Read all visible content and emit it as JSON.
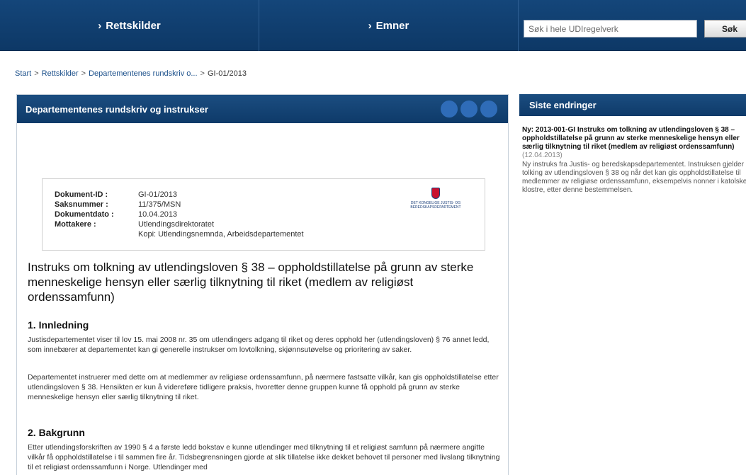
{
  "nav": {
    "tab1": "Rettskilder",
    "tab2": "Emner",
    "chevron": "›",
    "search_placeholder": "Søk i hele UDIregelverk",
    "search_button": "Søk"
  },
  "breadcrumb": {
    "items": [
      "Start",
      "Rettskilder",
      "Departementenes rundskriv o...",
      "GI-01/2013"
    ],
    "separator": ">"
  },
  "panel": {
    "title": "Departementenes rundskriv og instrukser"
  },
  "meta": {
    "rows": [
      {
        "label": "Dokument-ID :",
        "value": "GI-01/2013"
      },
      {
        "label": "Saksnummer :",
        "value": "11/375/MSN"
      },
      {
        "label": "Dokumentdato :",
        "value": "10.04.2013"
      },
      {
        "label": "Mottakere :",
        "value": "Utlendingsdirektoratet"
      },
      {
        "label": "",
        "value": "Kopi: Utlendingsnemnda, Arbeidsdepartementet"
      }
    ],
    "logo_text": "DET KONGELIGE JUSTIS- OG BEREDSKAPSDEPARTEMENT"
  },
  "doc": {
    "title": "Instruks om tolkning av utlendingsloven § 38 – oppholdstillatelse på grunn av sterke menneskelige hensyn eller særlig tilknytning til riket (medlem av religiøst ordenssamfunn)",
    "section1_heading": "1. Innledning",
    "section1_p1": "Justisdepartementet viser til lov 15. mai 2008 nr. 35 om utlendingers adgang til riket og deres opphold her (utlendingsloven) § 76 annet ledd, som innebærer at departementet kan gi generelle instrukser om lovtolkning, skjønnsutøvelse og prioritering av saker.",
    "section1_p2": "Departementet instruerer med dette om at medlemmer av religiøse ordenssamfunn, på nærmere fastsatte vilkår, kan gis oppholdstillatelse etter utlendingsloven § 38. Hensikten er kun å videreføre tidligere praksis, hvoretter denne gruppen kunne få opphold på grunn av sterke menneskelige hensyn eller særlig tilknytning til riket.",
    "section2_heading": "2. Bakgrunn",
    "section2_p1": "Etter utlendingsforskriften av 1990 § 4 a første ledd bokstav e kunne utlendinger med tilknytning til et religiøst samfunn på nærmere angitte vilkår få oppholdstillatelse i til sammen fire år. Tidsbegrensningen gjorde at slik tillatelse ikke dekket behovet til personer med livslang tilknytning til et religiøst ordenssamfunn i Norge. Utlendinger med"
  },
  "sidebar": {
    "title": "Siste endringer",
    "news_title": "Ny: 2013-001-GI Instruks om tolkning av utlendingsloven § 38 – oppholdstillatelse på grunn av sterke menneskelige hensyn eller særlig tilknytning til riket (medlem av religiøst ordenssamfunn)",
    "news_date": "(12.04.2013)",
    "news_body": "Ny instruks fra Justis- og beredskapsdepartementet. Instruksen gjelder tolking av utlendingsloven § 38 og når det kan gis oppholdstillatelse til medlemmer av religiøse ordenssamfunn, eksempelvis nonner i katolske klostre, etter denne bestemmelsen."
  },
  "colors": {
    "nav_bg": "#14467a",
    "header_bg": "#1b4d80",
    "dot": "#2f6cb8",
    "link": "#1a4f8a"
  }
}
